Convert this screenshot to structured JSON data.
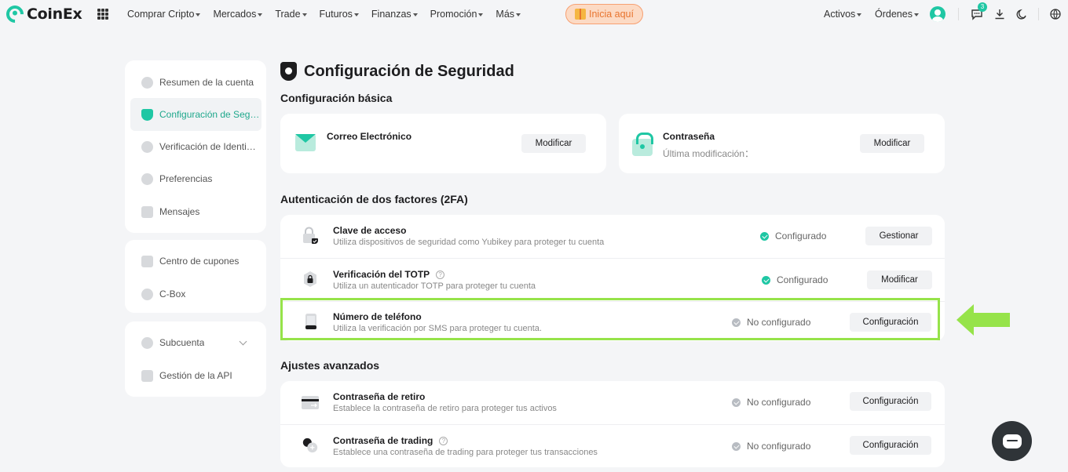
{
  "brand": {
    "name": "CoinEx",
    "accent": "#1fc7a4",
    "highlight": "#96e34a"
  },
  "nav": {
    "items": [
      "Comprar Cripto",
      "Mercados",
      "Trade",
      "Futuros",
      "Finanzas",
      "Promoción",
      "Más"
    ],
    "promo_label": "Inicia aquí",
    "assets": "Activos",
    "orders": "Órdenes",
    "notifications_count": "3"
  },
  "sidebar": {
    "group1": [
      {
        "label": "Resumen de la cuenta",
        "icon": "pie-chart-icon"
      },
      {
        "label": "Configuración de Seguridad",
        "icon": "shield-icon",
        "active": true
      },
      {
        "label": "Verificación de Identidad",
        "icon": "id-icon"
      },
      {
        "label": "Preferencias",
        "icon": "settings-icon"
      },
      {
        "label": "Mensajes",
        "icon": "message-icon"
      }
    ],
    "group2": [
      {
        "label": "Centro de cupones",
        "icon": "coupon-icon"
      },
      {
        "label": "C-Box",
        "icon": "gift-box-icon"
      }
    ],
    "group3": [
      {
        "label": "Subcuenta",
        "icon": "subaccount-icon"
      },
      {
        "label": "Gestión de la API",
        "icon": "api-icon"
      }
    ]
  },
  "main": {
    "title": "Configuración de Seguridad",
    "basic_heading": "Configuración básica",
    "email": {
      "title": "Correo Electrónico",
      "button": "Modificar"
    },
    "password": {
      "title": "Contraseña",
      "subtitle": "Última modificación：",
      "button": "Modificar"
    },
    "twofa_heading": "Autenticación de dos factores (2FA)",
    "twofa_rows": [
      {
        "title": "Clave de acceso",
        "desc": "Utiliza dispositivos de seguridad como Yubikey para proteger tu cuenta",
        "status": "Configurado",
        "button": "Gestionar"
      },
      {
        "title": "Verificación del TOTP",
        "desc": "Utiliza un autenticador TOTP para proteger tu cuenta",
        "status": "Configurado",
        "button": "Modificar"
      },
      {
        "title": "Número de teléfono",
        "desc": "Utiliza la verificación por SMS para proteger tu cuenta.",
        "status": "No configurado",
        "button": "Configuración"
      }
    ],
    "advanced_heading": "Ajustes avanzados",
    "advanced_rows": [
      {
        "title": "Contraseña de retiro",
        "desc": "Establece la contraseña de retiro para proteger tus activos",
        "status": "No configurado",
        "button": "Configuración"
      },
      {
        "title": "Contraseña de trading",
        "desc": "Establece una contraseña de trading para proteger tus transacciones",
        "status": "No configurado",
        "button": "Configuración"
      }
    ]
  }
}
